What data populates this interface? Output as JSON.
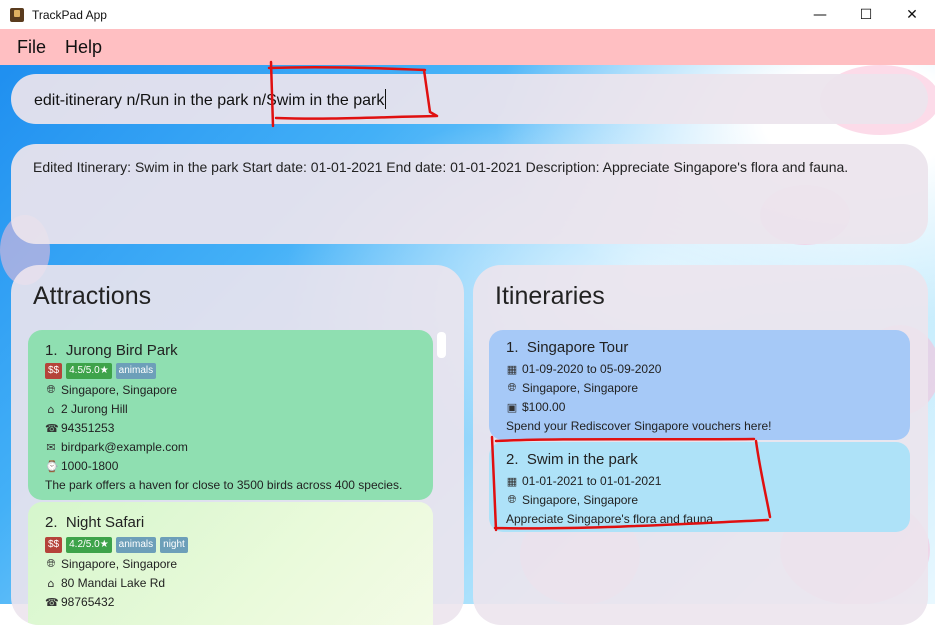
{
  "window": {
    "title": "TrackPad App"
  },
  "menu": {
    "file": "File",
    "help": "Help"
  },
  "command": {
    "value": "edit-itinerary n/Run in the park n/Swim in the park"
  },
  "result": {
    "text": "Edited Itinerary: Swim in the park Start date: 01-01-2021 End date: 01-01-2021 Description: Appreciate Singapore's flora and fauna."
  },
  "attractions": {
    "title": "Attractions",
    "items": [
      {
        "index": "1.",
        "name": "Jurong Bird Park",
        "price": "$$",
        "rating": "4.5/5.0★",
        "tags": [
          "animals"
        ],
        "location": "Singapore, Singapore",
        "address": "2 Jurong Hill",
        "phone": "94351253",
        "email": "birdpark@example.com",
        "hours": "1000-1800",
        "description": "The park offers a haven for close to 3500 birds across 400 species."
      },
      {
        "index": "2.",
        "name": "Night Safari",
        "price": "$$",
        "rating": "4.2/5.0★",
        "tags": [
          "animals",
          "night"
        ],
        "location": "Singapore, Singapore",
        "address": "80 Mandai Lake Rd",
        "phone": "98765432"
      }
    ]
  },
  "itineraries": {
    "title": "Itineraries",
    "items": [
      {
        "index": "1.",
        "name": "Singapore Tour",
        "dates": "01-09-2020 to 05-09-2020",
        "location": "Singapore, Singapore",
        "budget": "$100.00",
        "description": "Spend your Rediscover Singapore vouchers here!"
      },
      {
        "index": "2.",
        "name": "Swim in the park",
        "dates": "01-01-2021 to 01-01-2021",
        "location": "Singapore, Singapore",
        "description": "Appreciate Singapore's flora and fauna"
      }
    ]
  },
  "colors": {
    "menu_bar": "#ffbfc2",
    "attraction_card_1": "#8fdfb1",
    "itinerary_card_1": "#a6c9f7",
    "itinerary_card_2": "#aee2f8",
    "tag_price": "#b5433a",
    "tag_rating": "#3ea34a",
    "tag_label": "#6d9fb9",
    "annotation": "#e01010"
  },
  "icons": {
    "app": "app-icon",
    "minimize": "minimize-icon",
    "maximize": "maximize-icon",
    "close": "close-icon",
    "globe": "globe-icon",
    "home": "home-icon",
    "phone": "phone-icon",
    "email": "email-icon",
    "clock": "clock-icon",
    "calendar": "calendar-icon",
    "money": "money-icon"
  }
}
